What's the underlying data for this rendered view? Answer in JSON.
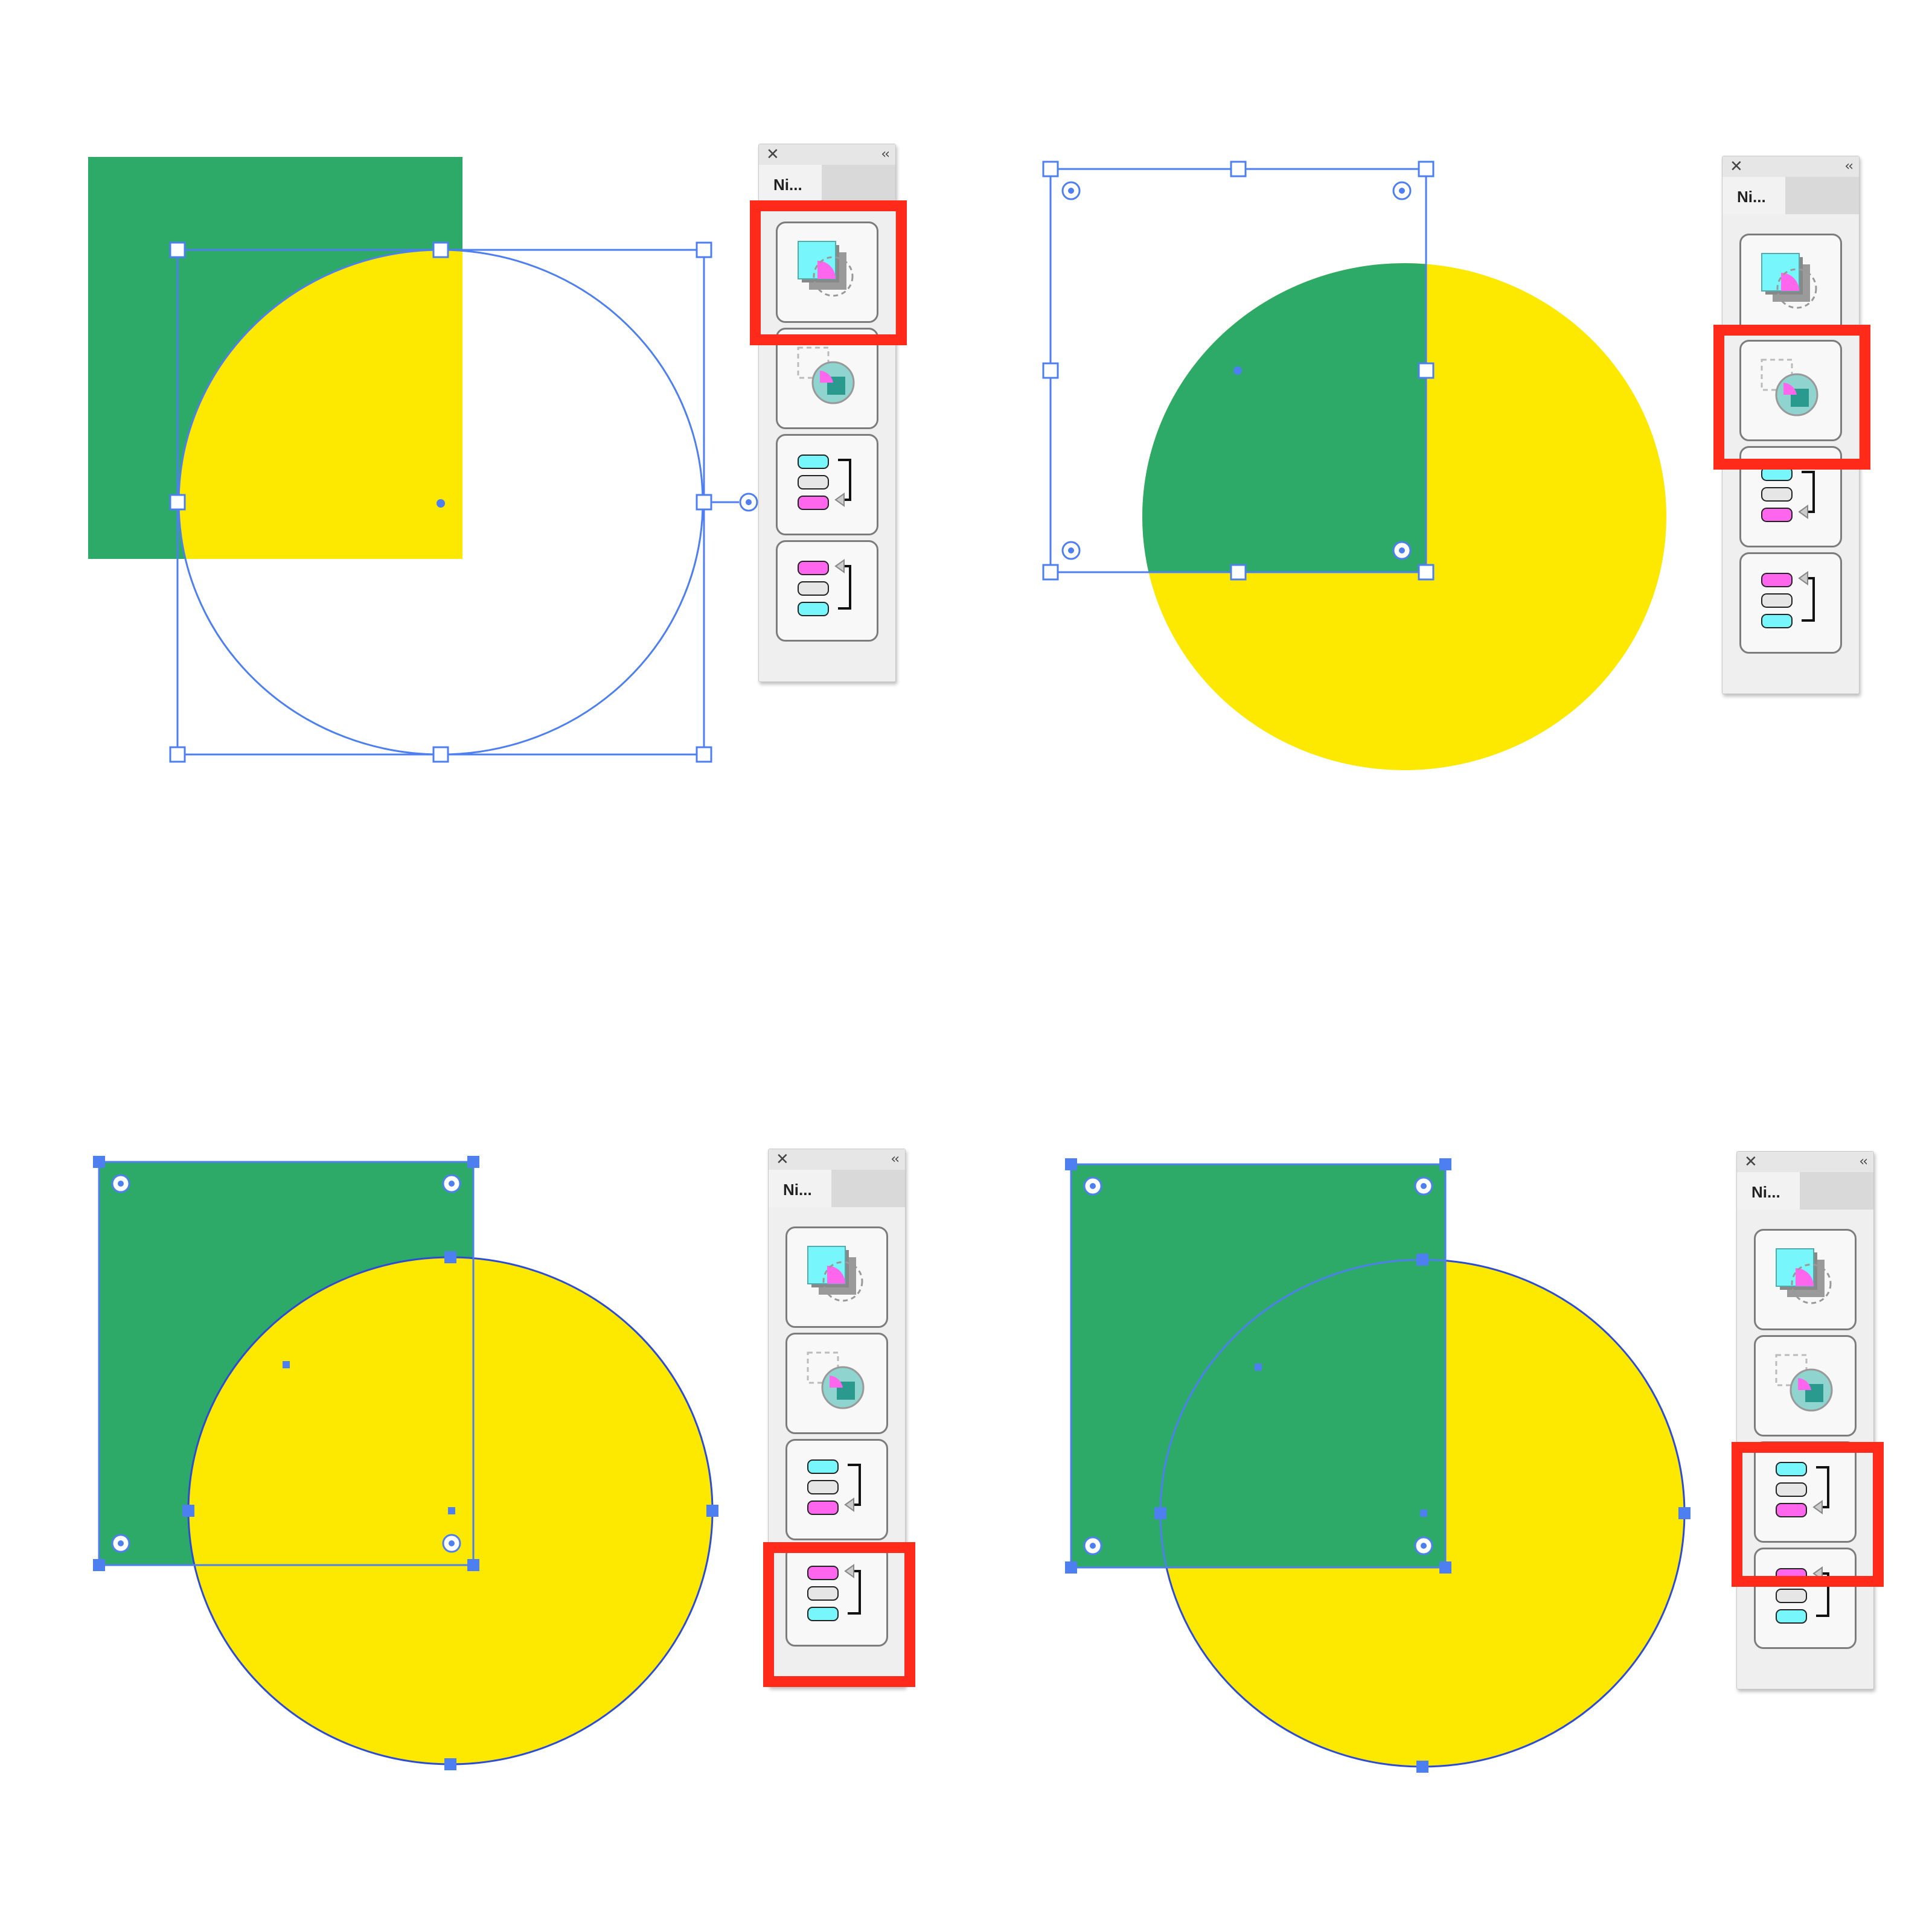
{
  "colors": {
    "square_fill": "#2eaa68",
    "circle_fill": "#fde800",
    "selection": "#4d7ff0",
    "highlight": "#ff2a1a",
    "panel_bg": "#efefef",
    "icon_cyan": "#77f7fb",
    "icon_magenta": "#ff66ee",
    "icon_gray": "#9a9a9a"
  },
  "panel": {
    "tab_label": "Ni...",
    "close_icon": "close-icon",
    "collapse_icon": "double-chevron-left-icon",
    "buttons": [
      {
        "name": "arrange-front-back-button",
        "icon": "layer-shapes-icon"
      },
      {
        "name": "arrange-send-back-button",
        "icon": "circle-in-frame-icon"
      },
      {
        "name": "reorder-down-button",
        "icon": "stack-down-icon"
      },
      {
        "name": "reorder-up-button",
        "icon": "stack-up-icon"
      }
    ]
  },
  "steps": [
    {
      "id": "step-1",
      "highlighted_button": 0,
      "selected_object": "circle"
    },
    {
      "id": "step-2",
      "highlighted_button": 1,
      "selected_object": "square"
    },
    {
      "id": "step-3",
      "highlighted_button": 3,
      "selected_object": "circle-and-square"
    },
    {
      "id": "step-4",
      "highlighted_button": 2,
      "selected_object": "circle-and-square"
    }
  ]
}
